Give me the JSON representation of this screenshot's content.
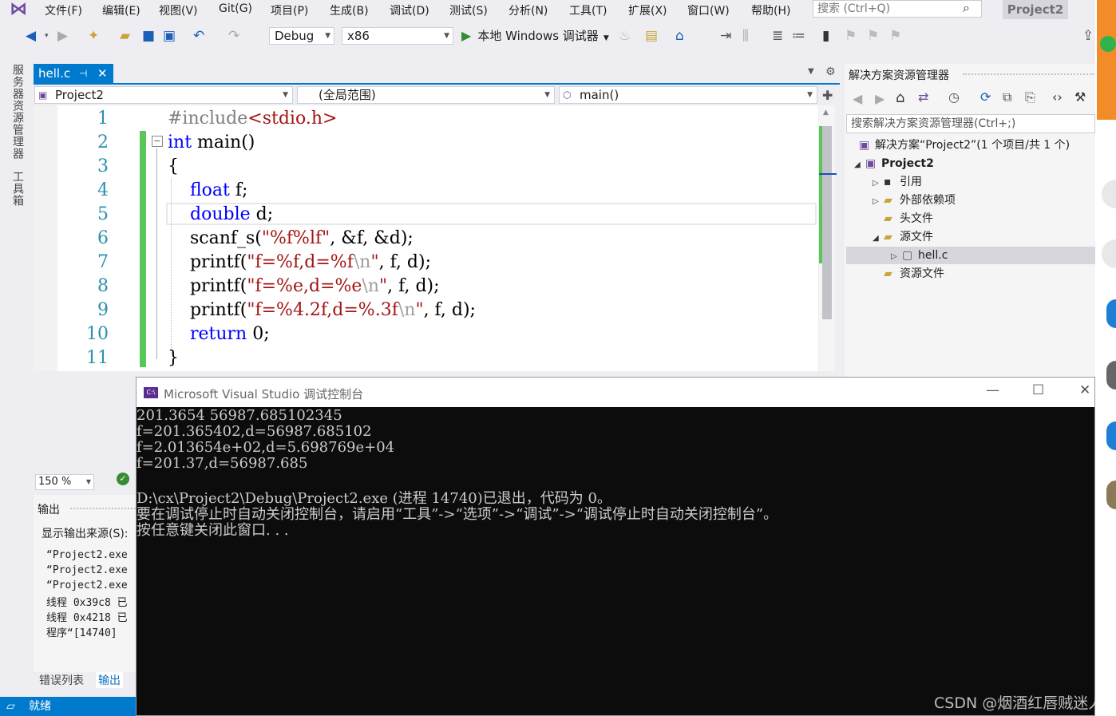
{
  "menu": [
    "文件(F)",
    "编辑(E)",
    "视图(V)",
    "Git(G)",
    "项目(P)",
    "生成(B)",
    "调试(D)",
    "测试(S)",
    "分析(N)",
    "工具(T)",
    "扩展(X)",
    "窗口(W)",
    "帮助(H)"
  ],
  "search": {
    "placeholder": "搜索 (Ctrl+Q)"
  },
  "project_badge": "Project2",
  "toolbar": {
    "config": "Debug",
    "platform": "x86",
    "run_label": "本地 Windows 调试器"
  },
  "left_tabs": [
    "服务器资源管理器",
    "工具箱"
  ],
  "editor": {
    "tab_name": "hell.c",
    "nav": {
      "project": "Project2",
      "scope": "(全局范围)",
      "function": "main()"
    },
    "line_numbers": [
      "1",
      "2",
      "3",
      "4",
      "5",
      "6",
      "7",
      "8",
      "9",
      "10",
      "11"
    ]
  },
  "solution": {
    "title": "解决方案资源管理器",
    "search_placeholder": "搜索解决方案资源管理器(Ctrl+;)",
    "items": [
      "解决方案“Project2”(1 个项目/共 1 个)",
      "Project2",
      "引用",
      "外部依赖项",
      "头文件",
      "源文件",
      "hell.c",
      "资源文件"
    ]
  },
  "zoom": "150 %",
  "output": {
    "title": "输出",
    "source_label": "显示输出来源(S):",
    "lines": [
      "“Project2.exe",
      "“Project2.exe",
      "“Project2.exe",
      "线程 0x39c8 已",
      "线程 0x4218 已",
      "程序“[14740]"
    ]
  },
  "bottom_tabs": [
    "错误列表",
    "输出"
  ],
  "status": "就绪",
  "console": {
    "title": "Microsoft Visual Studio 调试控制台",
    "lines": [
      "201.3654 56987.685102345",
      "f=201.365402,d=56987.685102",
      "f=2.013654e+02,d=5.698769e+04",
      "f=201.37,d=56987.685",
      "",
      "D:\\cx\\Project2\\Debug\\Project2.exe (进程 14740)已退出，代码为 0。",
      "要在调试停止时自动关闭控制台，请启用“工具”->“选项”->“调试”->“调试停止时自动关闭控制台”。",
      "按任意键关闭此窗口. . ."
    ]
  },
  "watermark": "CSDN @烟酒红唇贼迷人"
}
